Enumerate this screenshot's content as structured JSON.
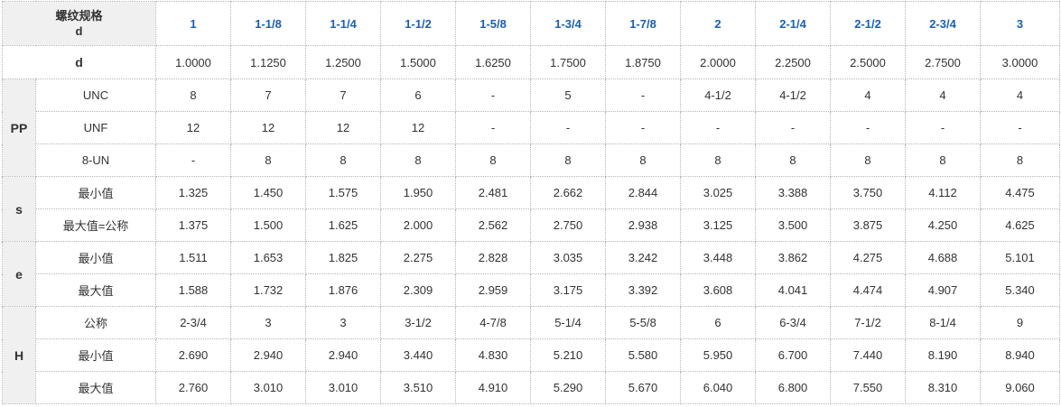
{
  "table": {
    "corner_line1": "螺纹规格",
    "corner_line2": "d",
    "sizes": [
      "1",
      "1-1/8",
      "1-1/4",
      "1-1/2",
      "1-5/8",
      "1-3/4",
      "1-7/8",
      "2",
      "2-1/4",
      "2-1/2",
      "2-3/4",
      "3"
    ],
    "d": {
      "label": "d",
      "values": [
        "1.0000",
        "1.1250",
        "1.2500",
        "1.5000",
        "1.6250",
        "1.7500",
        "1.8750",
        "2.0000",
        "2.2500",
        "2.5000",
        "2.7500",
        "3.0000"
      ]
    },
    "groups": [
      {
        "label": "PP",
        "rows": [
          {
            "label": "UNC",
            "values": [
              "8",
              "7",
              "7",
              "6",
              "-",
              "5",
              "-",
              "4-1/2",
              "4-1/2",
              "4",
              "4",
              "4"
            ]
          },
          {
            "label": "UNF",
            "values": [
              "12",
              "12",
              "12",
              "12",
              "-",
              "-",
              "-",
              "-",
              "-",
              "-",
              "-",
              "-"
            ]
          },
          {
            "label": "8-UN",
            "values": [
              "-",
              "8",
              "8",
              "8",
              "8",
              "8",
              "8",
              "8",
              "8",
              "8",
              "8",
              "8"
            ]
          }
        ]
      },
      {
        "label": "s",
        "rows": [
          {
            "label": "最小值",
            "values": [
              "1.325",
              "1.450",
              "1.575",
              "1.950",
              "2.481",
              "2.662",
              "2.844",
              "3.025",
              "3.388",
              "3.750",
              "4.112",
              "4.475"
            ]
          },
          {
            "label": "最大值=公称",
            "values": [
              "1.375",
              "1.500",
              "1.625",
              "2.000",
              "2.562",
              "2.750",
              "2.938",
              "3.125",
              "3.500",
              "3.875",
              "4.250",
              "4.625"
            ]
          }
        ]
      },
      {
        "label": "e",
        "rows": [
          {
            "label": "最小值",
            "values": [
              "1.511",
              "1.653",
              "1.825",
              "2.275",
              "2.828",
              "3.035",
              "3.242",
              "3.448",
              "3.862",
              "4.275",
              "4.688",
              "5.101"
            ]
          },
          {
            "label": "最大值",
            "values": [
              "1.588",
              "1.732",
              "1.876",
              "2.309",
              "2.959",
              "3.175",
              "3.392",
              "3.608",
              "4.041",
              "4.474",
              "4.907",
              "5.340"
            ]
          }
        ]
      },
      {
        "label": "H",
        "rows": [
          {
            "label": "公称",
            "values": [
              "2-3/4",
              "3",
              "3",
              "3-1/2",
              "4-7/8",
              "5-1/4",
              "5-5/8",
              "6",
              "6-3/4",
              "7-1/2",
              "8-1/4",
              "9"
            ]
          },
          {
            "label": "最小值",
            "values": [
              "2.690",
              "2.940",
              "2.940",
              "3.440",
              "4.830",
              "5.210",
              "5.580",
              "5.950",
              "6.700",
              "7.440",
              "8.190",
              "8.940"
            ]
          },
          {
            "label": "最大值",
            "values": [
              "2.760",
              "3.010",
              "3.010",
              "3.510",
              "4.910",
              "5.290",
              "5.670",
              "6.040",
              "6.800",
              "7.550",
              "8.310",
              "9.060"
            ]
          }
        ]
      }
    ]
  }
}
